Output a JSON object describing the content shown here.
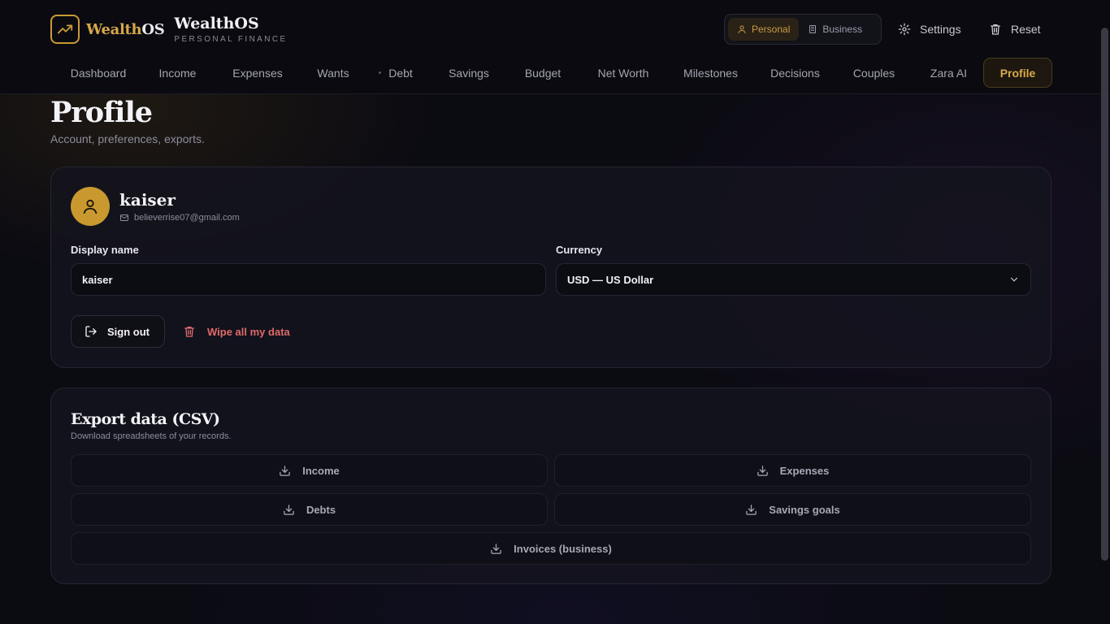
{
  "brand": {
    "logo_word": "Wealth",
    "logo_suffix": "OS",
    "title": "WealthOS",
    "subtitle": "PERSONAL FINANCE"
  },
  "mode_toggle": {
    "personal": "Personal",
    "business": "Business",
    "selected": "Personal"
  },
  "top_actions": {
    "settings": "Settings",
    "reset": "Reset"
  },
  "nav": {
    "items": [
      "Dashboard",
      "Income",
      "Expenses",
      "Wants",
      "Debt",
      "Savings",
      "Budget",
      "Net Worth",
      "Milestones",
      "Decisions",
      "Couples",
      "Zara AI",
      "Profile"
    ],
    "active": "Profile"
  },
  "page": {
    "title": "Profile",
    "subtitle": "Account, preferences, exports."
  },
  "profile": {
    "name": "kaiser",
    "email": "believerrise07@gmail.com",
    "display_name_label": "Display name",
    "display_name_value": "kaiser",
    "currency_label": "Currency",
    "currency_value": "USD — US Dollar",
    "sign_out": "Sign out",
    "wipe": "Wipe all my data"
  },
  "export": {
    "title": "Export data (CSV)",
    "subtitle": "Download spreadsheets of your records.",
    "buttons": [
      "Income",
      "Expenses",
      "Debts",
      "Savings goals",
      "Invoices (business)"
    ]
  },
  "colors": {
    "accent": "#c99a35",
    "danger": "#e06a6a",
    "background": "#0b0b12"
  },
  "icons": [
    "chart-line-icon",
    "user-icon",
    "building-icon",
    "gear-icon",
    "trash-icon",
    "mail-icon",
    "chevron-down-icon",
    "sign-out-icon",
    "download-icon"
  ]
}
